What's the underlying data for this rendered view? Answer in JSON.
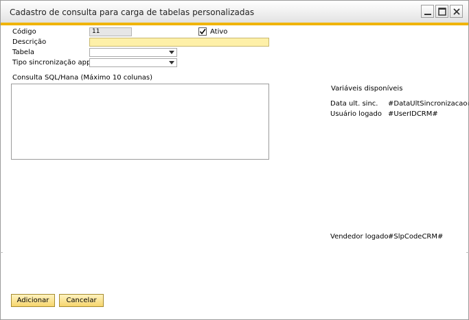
{
  "window": {
    "title": "Cadastro de consulta para carga de tabelas personalizadas"
  },
  "form": {
    "codigo_label": "Código",
    "codigo_value": "11",
    "ativo_label": "Ativo",
    "ativo_checked": true,
    "descricao_label": "Descrição",
    "descricao_value": "",
    "tabela_label": "Tabela",
    "tabela_value": "",
    "tipo_label": "Tipo sincronização app",
    "tipo_value": "",
    "consulta_label": "Consulta SQL/Hana (Máximo 10 colunas)",
    "consulta_value": ""
  },
  "variables": {
    "heading": "Variáveis disponíveis",
    "items": [
      {
        "label": "Data ult. sinc.",
        "value": "#DataUltSincronizacao#"
      },
      {
        "label": "Usuário logado",
        "value": "#UserIDCRM#"
      },
      {
        "label": "Vendedor logado",
        "value": "#SlpCodeCRM#"
      }
    ]
  },
  "buttons": {
    "add_label": "Adicionar",
    "cancel_label": "Cancelar"
  },
  "colors": {
    "accent": "#f0b400",
    "required_field": "#fef0a8",
    "button": "#f6d56d"
  }
}
